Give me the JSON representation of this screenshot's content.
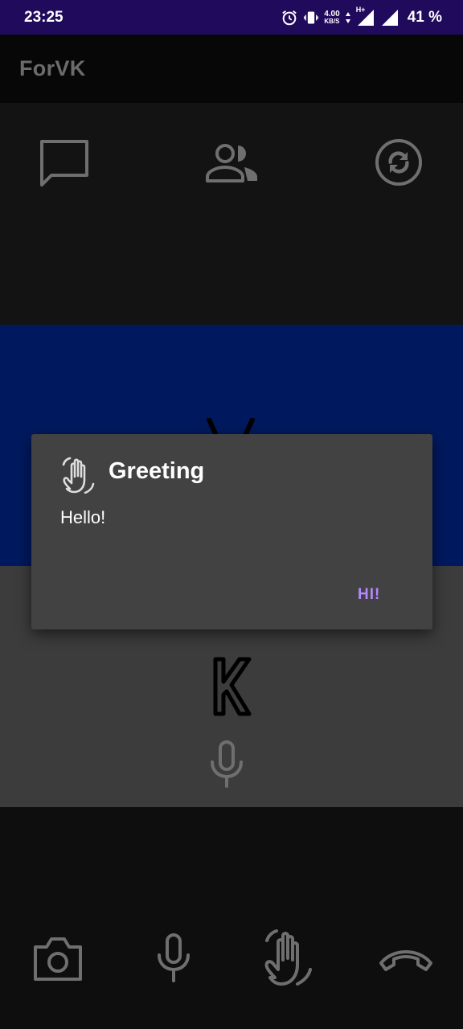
{
  "status_bar": {
    "time": "23:25",
    "net_speed_value": "4.00",
    "net_speed_unit": "KB/S",
    "network_type": "H+",
    "battery": "41 %",
    "background_color": "#1f0a5c"
  },
  "app_bar": {
    "title": "ForVK"
  },
  "top_nav": {
    "icons": [
      "chat-bubble-icon",
      "people-icon",
      "sync-icon"
    ]
  },
  "dialog": {
    "icon": "wave-hand-icon",
    "title": "Greeting",
    "message": "Hello!",
    "button_label": "HI!",
    "accent_color": "#b388ff"
  },
  "call_area": {
    "logo_letter": "K",
    "icons": [
      "microphone-icon"
    ]
  },
  "bottom_bar": {
    "icons": [
      "camera-icon",
      "microphone-icon",
      "wave-hand-icon",
      "end-call-icon"
    ]
  },
  "colors": {
    "video_area": "#00195e",
    "call_area": "#3c3c3c",
    "dialog_background": "#424242"
  }
}
